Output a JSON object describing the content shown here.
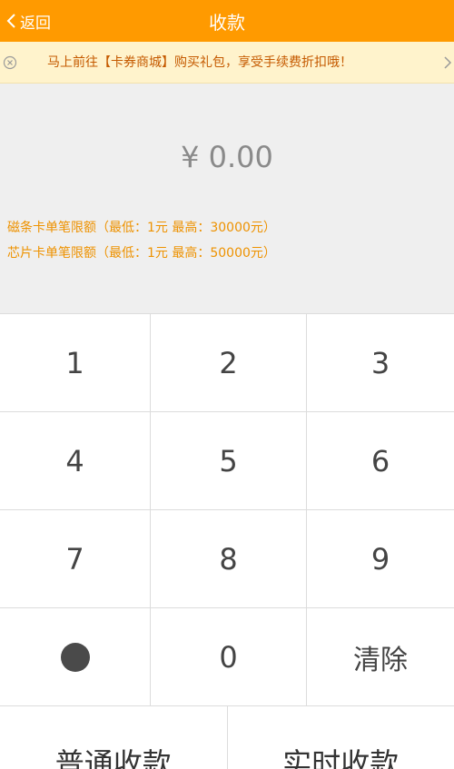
{
  "header": {
    "back_label": "返回",
    "title": "收款",
    "accent_color": "#ff9a00"
  },
  "banner": {
    "text": "马上前往【卡券商城】购买礼包，享受手续费折扣哦！",
    "close_icon": "close-circle-icon",
    "arrow_icon": "chevron-right-icon"
  },
  "display": {
    "amount": "¥ 0.00",
    "limits": [
      "磁条卡单笔限额（最低：1元  最高：30000元）",
      "芯片卡单笔限额（最低：1元  最高：50000元）"
    ]
  },
  "keypad": {
    "keys": [
      "1",
      "2",
      "3",
      "4",
      "5",
      "6",
      "7",
      "8",
      "9",
      "",
      "0",
      "清除"
    ],
    "decimal_icon": "dot-icon"
  },
  "actions": {
    "normal": "普通收款",
    "realtime": "实时收款"
  }
}
